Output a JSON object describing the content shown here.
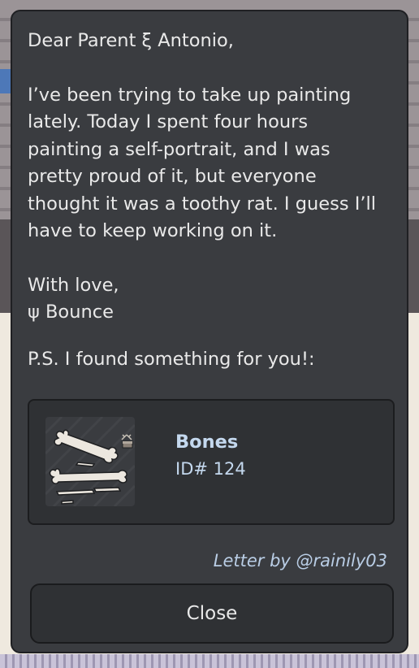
{
  "letter": {
    "greeting": "Dear Parent ξ Antonio,",
    "body": "I’ve been trying to take up painting lately. Today I spent four hours painting a self-portrait, and I was pretty proud of it, but everyone thought it was a toothy rat. I guess I’ll have to keep working on it.",
    "sign_off": "With love,",
    "signature": "ψ Bounce",
    "postscript": "P.S. I found something for you!:"
  },
  "gift": {
    "name": "Bones",
    "id_label": "ID# 124",
    "icon": "bones-icon"
  },
  "credit": "Letter by @rainily03",
  "close_label": "Close",
  "colors": {
    "dialog_bg": "#3a3c40",
    "card_bg": "#2f3134",
    "accent_text": "#c4d8ee"
  }
}
